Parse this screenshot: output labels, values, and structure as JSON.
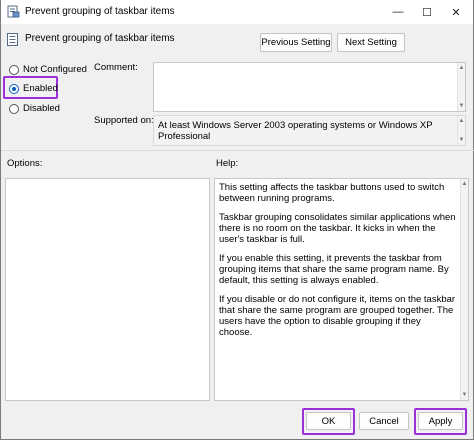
{
  "window": {
    "title": "Prevent grouping of taskbar items",
    "minimize_glyph": "—",
    "maximize_glyph": "☐",
    "close_glyph": "✕"
  },
  "header": {
    "policy_title": "Prevent grouping of taskbar items",
    "prev_button": "Previous Setting",
    "next_button": "Next Setting"
  },
  "state": {
    "options": [
      {
        "label": "Not Configured",
        "selected": false
      },
      {
        "label": "Enabled",
        "selected": true
      },
      {
        "label": "Disabled",
        "selected": false
      }
    ]
  },
  "fields": {
    "comment_label": "Comment:",
    "comment_value": "",
    "supported_label": "Supported on:",
    "supported_value": "At least Windows Server 2003 operating systems or Windows XP Professional"
  },
  "panes": {
    "options_label": "Options:",
    "help_label": "Help:",
    "help_paragraphs": [
      "This setting affects the taskbar buttons used to switch between running programs.",
      "Taskbar grouping consolidates similar applications when there is no room on the taskbar. It kicks in when the user's taskbar is full.",
      "If you enable this setting, it prevents the taskbar from grouping items that share the same program name. By default, this setting is always enabled.",
      "If you disable or do not configure it, items on the taskbar that share the same program are grouped together. The users have the option to disable grouping if they choose."
    ]
  },
  "footer": {
    "ok": "OK",
    "cancel": "Cancel",
    "apply": "Apply"
  },
  "colors": {
    "highlight": "#9b30d9",
    "radio_accent": "#0a5ec2"
  },
  "icons": {
    "app": "policy-document-icon",
    "header": "policy-setting-icon"
  }
}
